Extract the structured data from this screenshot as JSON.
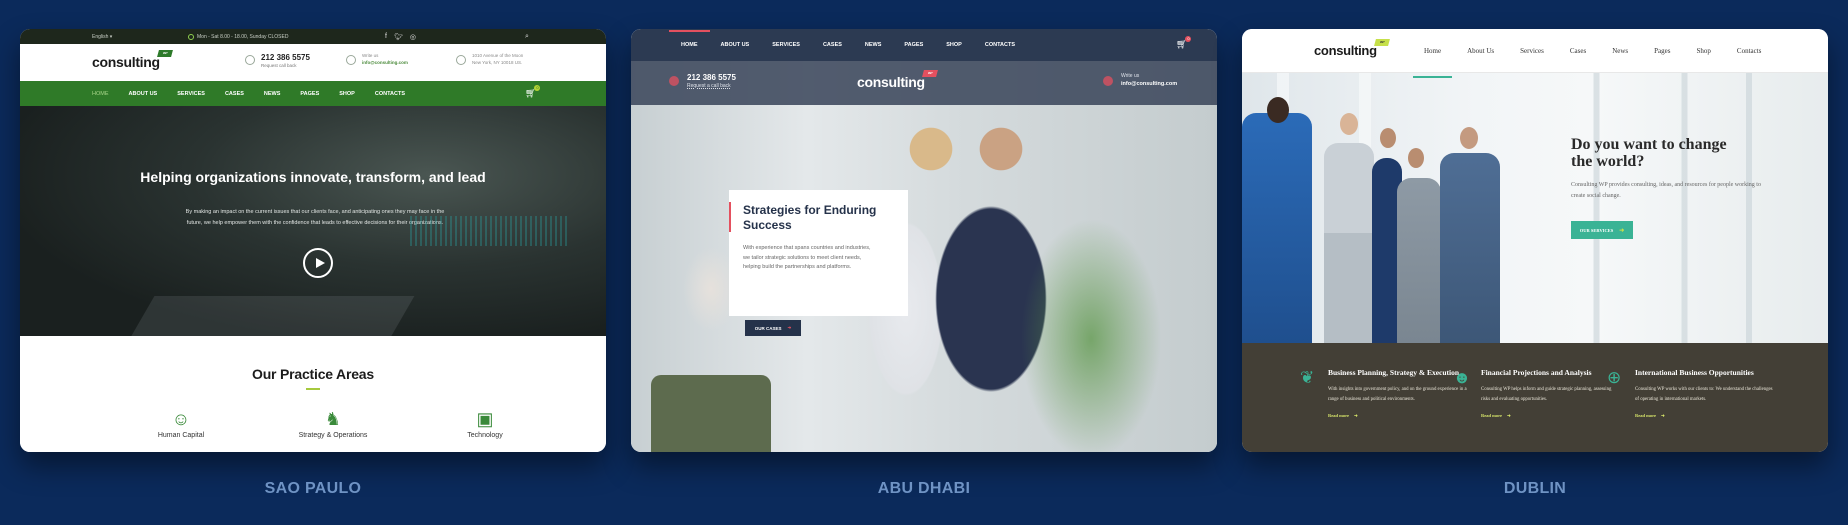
{
  "background_color": "#0b2a5b",
  "demos": [
    {
      "label": "SAO PAULO",
      "accent": "#2f7a28",
      "topbar": {
        "language": "English",
        "hours": "Mon - Sat 8.00 - 18.00, Sunday CLOSED",
        "social_icons": [
          "facebook-icon",
          "twitter-icon",
          "instagram-icon"
        ],
        "search_icon": "search-icon"
      },
      "logo": {
        "text": "consulting",
        "badge": "WP"
      },
      "contacts": [
        {
          "icon": "phone-icon",
          "line1": "212 386 5575",
          "line2": "Request call back"
        },
        {
          "icon": "envelope-icon",
          "line1": "Write us",
          "line2": "info@consulting.com"
        },
        {
          "icon": "location-icon",
          "line1": "1010 Avenue of the Moon",
          "line2": "New York, NY 10018 US."
        }
      ],
      "nav": [
        "HOME",
        "ABOUT US",
        "SERVICES",
        "CASES",
        "NEWS",
        "PAGES",
        "SHOP",
        "CONTACTS"
      ],
      "nav_active": "HOME",
      "cart_count": "0",
      "hero": {
        "title": "Helping organizations innovate, transform, and lead",
        "text": "By making an impact on the current issues that our clients face, and anticipating ones they may face in the future, we help empower them with the confidence that leads to effective decisions for their organizations.",
        "play_icon": "play-icon"
      },
      "practice": {
        "title": "Our Practice Areas",
        "areas": [
          {
            "icon": "head-clock-icon",
            "glyph": "☺",
            "label": "Human Capital"
          },
          {
            "icon": "chess-knight-icon",
            "glyph": "♞",
            "label": "Strategy & Operations"
          },
          {
            "icon": "chip-icon",
            "glyph": "▣",
            "label": "Technology"
          }
        ]
      }
    },
    {
      "label": "ABU DHABI",
      "accent": "#e4505f",
      "nav": [
        "HOME",
        "ABOUT US",
        "SERVICES",
        "CASES",
        "NEWS",
        "PAGES",
        "SHOP",
        "CONTACTS"
      ],
      "nav_active": "HOME",
      "cart_count": "0",
      "logo": {
        "text": "consulting",
        "badge": "WP"
      },
      "contacts": [
        {
          "icon": "phone-icon",
          "line1": "212 386 5575",
          "line2": "Request a call back"
        },
        {
          "icon": "envelope-icon",
          "line1": "Write us",
          "line2": "info@consulting.com"
        }
      ],
      "hero": {
        "title": "Strategies for Enduring Success",
        "text": "With experience that spans countries and industries, we tailor strategic solutions to meet client needs, helping build the partnerships and platforms.",
        "button": "OUR CASES"
      }
    },
    {
      "label": "DUBLIN",
      "accent": "#3ab395",
      "logo": {
        "text": "consulting",
        "badge": "WP"
      },
      "nav": [
        "Home",
        "About Us",
        "Services",
        "Cases",
        "News",
        "Pages",
        "Shop",
        "Contacts"
      ],
      "nav_active": "Home",
      "hero": {
        "title": "Do you want to change the world?",
        "text": "Consulting WP provides consulting, ideas, and resources for people working to create social change.",
        "button": "OUR SERVICES"
      },
      "services": [
        {
          "icon": "hand-plant-icon",
          "glyph": "❦",
          "title": "Business Planning, Strategy & Execution",
          "text": "With insights into government policy, and on the ground experience in a range of business and political environments.",
          "link": "Read more"
        },
        {
          "icon": "head-brain-icon",
          "glyph": "☻",
          "title": "Financial Projections and Analysis",
          "text": "Consulting WP helps inform and guide strategic planning, assessing risks and evaluating opportunities.",
          "link": "Read more"
        },
        {
          "icon": "globe-person-icon",
          "glyph": "⊕",
          "title": "International Business Opportunities",
          "text": "Consulting WP works with our clients to: We understand the challenges of operating in international markets.",
          "link": "Read more"
        }
      ]
    }
  ]
}
